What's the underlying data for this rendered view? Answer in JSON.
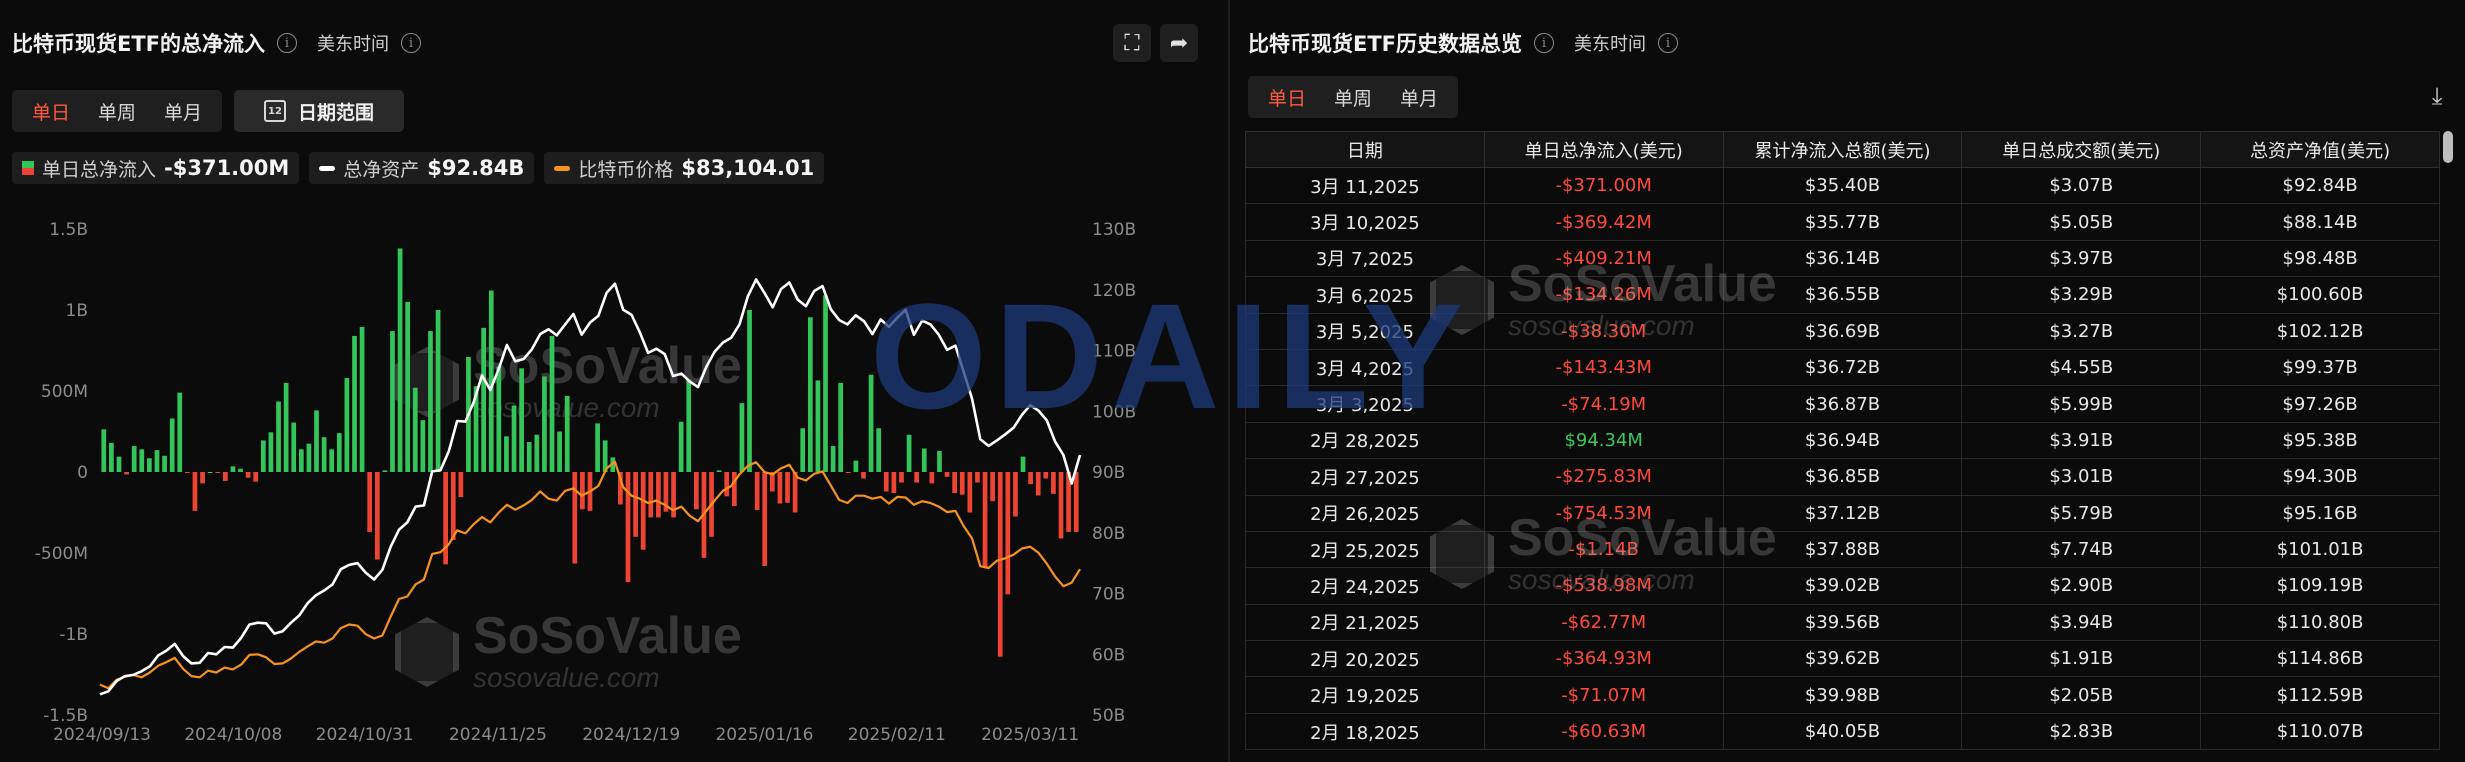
{
  "left": {
    "title": "比特币现货ETF的总净流入",
    "timezone": "美东时间",
    "periods": [
      "单日",
      "单周",
      "单月"
    ],
    "active_period": "单日",
    "date_range_label": "日期范围",
    "calendar_glyph": "12",
    "legend": [
      {
        "label": "单日总净流入",
        "value": "-$371.00M"
      },
      {
        "label": "总净资产",
        "value": "$92.84B"
      },
      {
        "label": "比特币价格",
        "value": "$83,104.01"
      }
    ]
  },
  "right": {
    "title": "比特币现货ETF历史数据总览",
    "timezone": "美东时间",
    "periods": [
      "单日",
      "单周",
      "单月"
    ],
    "active_period": "单日",
    "columns": [
      "日期",
      "单日总净流入(美元)",
      "累计净流入总额(美元)",
      "单日总成交额(美元)",
      "总资产净值(美元)"
    ],
    "rows": [
      [
        "3月 11,2025",
        "-$371.00M",
        "$35.40B",
        "$3.07B",
        "$92.84B"
      ],
      [
        "3月 10,2025",
        "-$369.42M",
        "$35.77B",
        "$5.05B",
        "$88.14B"
      ],
      [
        "3月 7,2025",
        "-$409.21M",
        "$36.14B",
        "$3.97B",
        "$98.48B"
      ],
      [
        "3月 6,2025",
        "-$134.26M",
        "$36.55B",
        "$3.29B",
        "$100.60B"
      ],
      [
        "3月 5,2025",
        "-$38.30M",
        "$36.69B",
        "$3.27B",
        "$102.12B"
      ],
      [
        "3月 4,2025",
        "-$143.43M",
        "$36.72B",
        "$4.55B",
        "$99.37B"
      ],
      [
        "3月 3,2025",
        "-$74.19M",
        "$36.87B",
        "$5.99B",
        "$97.26B"
      ],
      [
        "2月 28,2025",
        "$94.34M",
        "$36.94B",
        "$3.91B",
        "$95.38B"
      ],
      [
        "2月 27,2025",
        "-$275.83M",
        "$36.85B",
        "$3.01B",
        "$94.30B"
      ],
      [
        "2月 26,2025",
        "-$754.53M",
        "$37.12B",
        "$5.79B",
        "$95.16B"
      ],
      [
        "2月 25,2025",
        "-$1.14B",
        "$37.88B",
        "$7.74B",
        "$101.01B"
      ],
      [
        "2月 24,2025",
        "-$538.98M",
        "$39.02B",
        "$2.90B",
        "$109.19B"
      ],
      [
        "2月 21,2025",
        "-$62.77M",
        "$39.56B",
        "$3.94B",
        "$110.80B"
      ],
      [
        "2月 20,2025",
        "-$364.93M",
        "$39.62B",
        "$1.91B",
        "$114.86B"
      ],
      [
        "2月 19,2025",
        "-$71.07M",
        "$39.98B",
        "$2.05B",
        "$112.59B"
      ],
      [
        "2月 18,2025",
        "-$60.63M",
        "$40.05B",
        "$2.83B",
        "$110.07B"
      ]
    ]
  },
  "watermark": {
    "brand": "SoSoValue",
    "domain": "sosovalue.com",
    "overlay": "ODAILY"
  },
  "colors": {
    "inflow": "#33c55a",
    "outflow": "#ee4433",
    "assets_line": "#ffffff",
    "price_line": "#f7931a",
    "active": "#ff5a3c"
  },
  "chart_data": {
    "type": "bar",
    "x_ticks": [
      "2024/09/13",
      "2024/10/08",
      "2024/10/31",
      "2024/11/25",
      "2024/12/19",
      "2025/01/16",
      "2025/02/11",
      "2025/03/11"
    ],
    "y_left_ticks": [
      "1.5B",
      "1B",
      "500M",
      "0",
      "-500M",
      "-1B",
      "-1.5B"
    ],
    "y_left_range": [
      -1500000000,
      1500000000
    ],
    "y_right_ticks": [
      "130B",
      "120B",
      "110B",
      "100B",
      "90B",
      "80B",
      "70B",
      "60B",
      "50B"
    ],
    "y_right_range": [
      50,
      130
    ],
    "grid": false,
    "series": [
      {
        "name": "单日总净流入",
        "kind": "bar",
        "axis": "left",
        "unit": "M USD",
        "values": [
          263,
          180,
          95,
          -15,
          160,
          140,
          85,
          135,
          100,
          330,
          490,
          -4,
          -240,
          -70,
          0,
          -4,
          -55,
          35,
          20,
          -35,
          -60,
          195,
          245,
          435,
          550,
          305,
          140,
          175,
          380,
          215,
          140,
          240,
          580,
          840,
          895,
          -370,
          -540,
          10,
          870,
          1380,
          1050,
          520,
          320,
          870,
          1000,
          -570,
          -420,
          -155,
          710,
          530,
          890,
          1120,
          650,
          220,
          410,
          640,
          185,
          230,
          590,
          840,
          250,
          470,
          -565,
          -230,
          -240,
          300,
          195,
          90,
          -200,
          -680,
          -400,
          -480,
          -280,
          -280,
          -245,
          -280,
          310,
          570,
          -230,
          -530,
          -400,
          10,
          -150,
          -210,
          425,
          1000,
          -235,
          -580,
          -120,
          -195,
          -190,
          -250,
          270,
          955,
          565,
          1090,
          160,
          550,
          -5,
          70,
          -40,
          600,
          270,
          -120,
          -130,
          -65,
          230,
          -65,
          145,
          -70,
          130,
          -30,
          -130,
          -140,
          -250,
          -65,
          -590,
          -180,
          -1140,
          -755,
          -275,
          95,
          -75,
          -145,
          -40,
          -135,
          -410,
          -370,
          -370
        ]
      },
      {
        "name": "总净资产",
        "kind": "line",
        "axis": "right",
        "unit": "B USD",
        "values": [
          53.4,
          53.9,
          55.6,
          56.4,
          56.6,
          57.2,
          58.0,
          59.8,
          60.6,
          61.7,
          59.7,
          58.5,
          58.6,
          60.2,
          60.0,
          61.2,
          61.1,
          62.7,
          64.9,
          65.2,
          65.1,
          63.4,
          63.8,
          65.2,
          66.4,
          68.4,
          69.7,
          70.5,
          71.5,
          74.0,
          74.7,
          75.0,
          73.4,
          72.3,
          73.9,
          77.7,
          80.5,
          81.7,
          84.3,
          84.5,
          90.1,
          90.3,
          93.4,
          98.4,
          98.3,
          101.5,
          105.9,
          103.5,
          106.9,
          110.9,
          108.2,
          108.6,
          110.2,
          112.7,
          113.5,
          112.5,
          114.3,
          116.0,
          112.6,
          114.6,
          115.7,
          119.5,
          121.0,
          116.7,
          115.9,
          113.0,
          109.6,
          110.3,
          109.4,
          105.8,
          106.2,
          104.9,
          104.0,
          107.3,
          109.8,
          111.3,
          112.1,
          114.3,
          118.9,
          121.7,
          119.5,
          117.1,
          120.1,
          121.2,
          118.4,
          117.3,
          119.8,
          120.6,
          116.8,
          115.0,
          114.3,
          115.8,
          114.8,
          112.7,
          115.1,
          113.9,
          115.4,
          116.7,
          112.6,
          114.9,
          114.3,
          112.6,
          110.1,
          110.8,
          106.5,
          102.1,
          95.4,
          94.3,
          95.2,
          96.2,
          97.3,
          99.4,
          101.0,
          100.1,
          98.5,
          95.0,
          92.8,
          88.1,
          92.8
        ]
      },
      {
        "name": "比特币价格",
        "kind": "line",
        "axis": "right",
        "unit": "K USD",
        "values": [
          55.0,
          54.4,
          55.8,
          56.3,
          56.6,
          56.2,
          57.0,
          58.1,
          58.7,
          59.4,
          57.6,
          56.4,
          56.2,
          57.3,
          57.0,
          57.8,
          57.5,
          58.3,
          59.9,
          60.0,
          59.5,
          58.4,
          58.5,
          59.3,
          60.4,
          61.3,
          62.1,
          61.9,
          62.6,
          64.3,
          64.9,
          64.7,
          63.3,
          62.6,
          63.1,
          66.2,
          69.1,
          69.5,
          71.5,
          72.3,
          76.5,
          76.8,
          78.1,
          80.4,
          79.9,
          81.4,
          82.6,
          81.7,
          83.3,
          84.6,
          83.8,
          84.5,
          85.4,
          86.8,
          85.6,
          85.3,
          86.9,
          87.3,
          86.1,
          86.8,
          87.7,
          90.6,
          91.7,
          87.5,
          86.1,
          85.6,
          84.9,
          85.3,
          84.6,
          83.7,
          84.3,
          82.8,
          81.9,
          83.6,
          85.3,
          86.9,
          87.7,
          89.6,
          91.0,
          91.6,
          90.0,
          89.6,
          90.6,
          91.2,
          89.1,
          88.6,
          89.7,
          90.1,
          87.8,
          85.4,
          84.9,
          86.1,
          86.1,
          85.6,
          85.9,
          84.8,
          85.9,
          85.8,
          84.6,
          85.2,
          84.9,
          84.3,
          83.4,
          83.6,
          81.1,
          79.1,
          74.5,
          74.2,
          75.4,
          75.8,
          76.4,
          77.4,
          77.7,
          76.7,
          74.9,
          72.8,
          71.2,
          71.8,
          74.0
        ]
      }
    ]
  }
}
